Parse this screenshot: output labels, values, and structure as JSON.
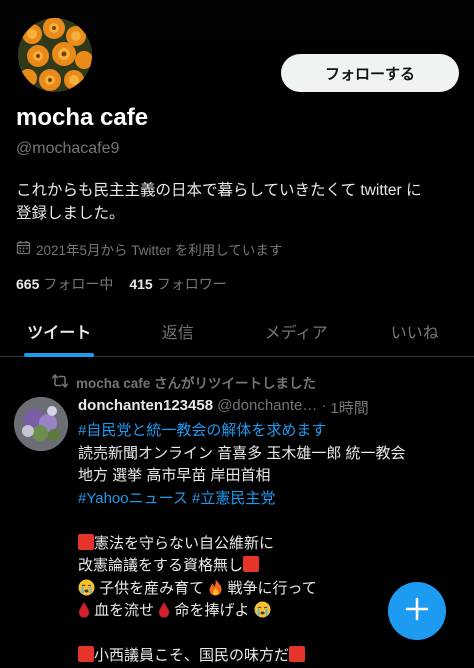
{
  "profile": {
    "follow_label": "フォローする",
    "name": "mocha cafe",
    "handle": "@mochacafe9",
    "bio_line1": "これからも民主主義の日本で暮らしていきたくて twitter に",
    "bio_line2": "登録しました。",
    "joined": "2021年5月から Twitter を利用しています",
    "following_count": "665",
    "following_label": "フォロー中",
    "followers_count": "415",
    "followers_label": "フォロワー"
  },
  "tabs": [
    {
      "label": "ツイート",
      "active": true
    },
    {
      "label": "返信",
      "active": false
    },
    {
      "label": "メディア",
      "active": false
    },
    {
      "label": "いいね",
      "active": false
    }
  ],
  "tweet": {
    "retweet_notice": "mocha cafe さんがリツイートしました",
    "author": "donchanten123458",
    "handle": "@donchante…",
    "separator": "·",
    "time": "1時間",
    "hashtag1": "#自民党と統一教会の解体を求めます",
    "line2": "読売新聞オンライン 音喜多 玉木雄一郎  統一教会",
    "line3": "地方 選挙 高市早苗 岸田首相",
    "hashtag_yahoo": "#Yahooニュース",
    "hashtag_party": "#立憲民主党",
    "line5": "憲法を守らない自公維新に",
    "line6": "改憲論議をする資格無し",
    "line7a": "子供を産み育て",
    "line7b": "戦争に行って",
    "line8a": "血を流せ",
    "line8b": "命を捧げよ",
    "line9": "小西議員こそ、国民の味方だ"
  },
  "icons": {
    "calendar": "calendar-icon",
    "retweet": "retweet-icon",
    "compose": "plus-icon"
  },
  "colors": {
    "accent": "#1d9bf0",
    "background": "#000000",
    "muted": "#71767b"
  }
}
